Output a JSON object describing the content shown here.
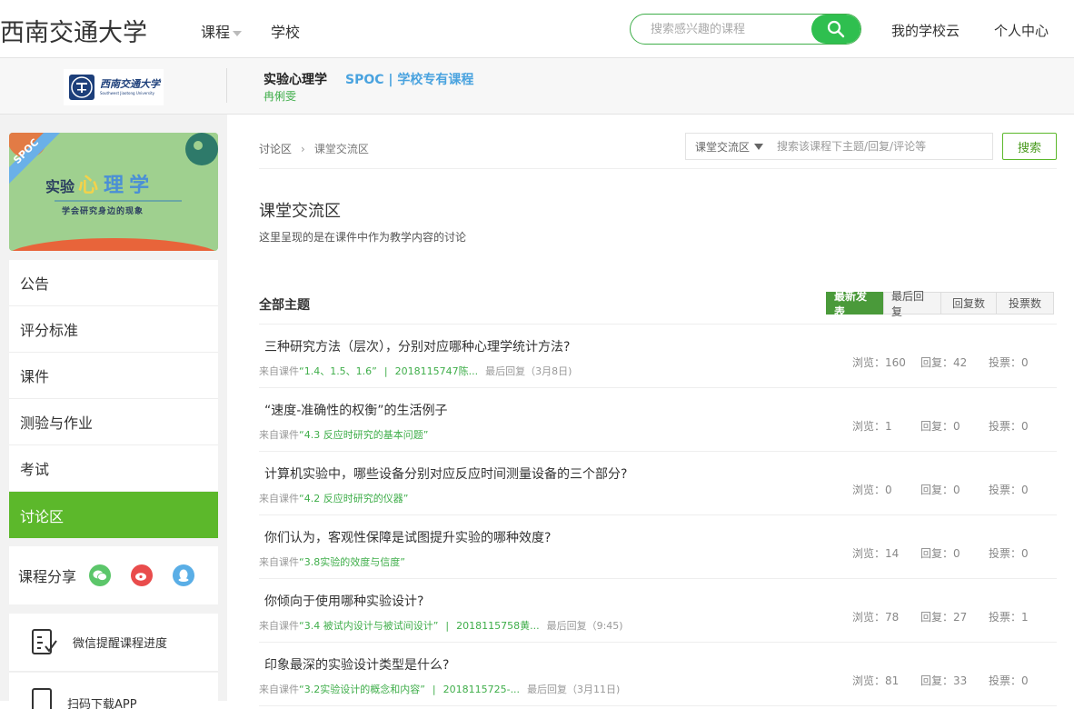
{
  "header": {
    "brand": "西南交通大学",
    "nav": [
      {
        "label": "课程",
        "has_caret": true
      },
      {
        "label": "学校",
        "has_caret": false
      }
    ],
    "search": {
      "placeholder": "搜索感兴趣的课程"
    },
    "links": [
      "我的学校云",
      "个人中心"
    ],
    "accent_color": "#2fbf4f"
  },
  "course_band": {
    "logo_cn": "西南交通大学",
    "logo_en": "Southwest Jiaotong University",
    "course_name": "实验心理学",
    "course_type": "SPOC | 学校专有课程",
    "teacher": "冉俐雯"
  },
  "sidebar": {
    "cover": {
      "badge": "SPOC",
      "title_chars": [
        "实",
        "验",
        "心",
        "理",
        "学"
      ],
      "subtitle": "学会研究身边的现象"
    },
    "menu": [
      {
        "label": "公告",
        "active": false
      },
      {
        "label": "评分标准",
        "active": false
      },
      {
        "label": "课件",
        "active": false
      },
      {
        "label": "测验与作业",
        "active": false
      },
      {
        "label": "考试",
        "active": false
      },
      {
        "label": "讨论区",
        "active": true
      }
    ],
    "share": {
      "label": "课程分享",
      "icons": [
        "wechat-icon",
        "weibo-icon",
        "qq-icon"
      ]
    },
    "remind": {
      "label": "微信提醒课程进度"
    },
    "app": {
      "label": "扫码下载APP"
    }
  },
  "main": {
    "breadcrumb": {
      "root": "讨论区",
      "current": "课堂交流区"
    },
    "scope_select": "课堂交流区",
    "search_placeholder": "搜索该课程下主题/回复/评论等",
    "search_button": "搜索",
    "forum_title": "课堂交流区",
    "forum_desc": "这里呈现的是在课件中作为教学内容的讨论",
    "all_topics": "全部主题",
    "sort_tabs": [
      {
        "label": "最新发表",
        "active": true
      },
      {
        "label": "最后回复",
        "active": false
      },
      {
        "label": "回复数",
        "active": false
      },
      {
        "label": "投票数",
        "active": false
      }
    ],
    "stat_labels": {
      "views": "浏览",
      "replies": "回复",
      "votes": "投票"
    },
    "topics": [
      {
        "title": "三种研究方法（层次），分别对应哪种心理学统计方法?",
        "source_prefix": "来自课件",
        "source": "“1.4、1.5、1.6”",
        "author": "2018115747陈...",
        "last_reply": "最后回复（3月8日)",
        "views": "160",
        "replies": "42",
        "votes": "0"
      },
      {
        "title": "“速度-准确性的权衡”的生活例子",
        "source_prefix": "来自课件",
        "source": "“4.3 反应时研究的基本问题”",
        "author": "",
        "last_reply": "",
        "views": "1",
        "replies": "0",
        "votes": "0"
      },
      {
        "title": "计算机实验中，哪些设备分别对应反应时间测量设备的三个部分?",
        "source_prefix": "来自课件",
        "source": "“4.2 反应时研究的仪器”",
        "author": "",
        "last_reply": "",
        "views": "0",
        "replies": "0",
        "votes": "0"
      },
      {
        "title": "你们认为，客观性保障是试图提升实验的哪种效度?",
        "source_prefix": "来自课件",
        "source": "“3.8实验的效度与信度”",
        "author": "",
        "last_reply": "",
        "views": "14",
        "replies": "0",
        "votes": "0"
      },
      {
        "title": "你倾向于使用哪种实验设计?",
        "source_prefix": "来自课件",
        "source": "“3.4 被试内设计与被试间设计”",
        "author": "2018115758黄...",
        "last_reply": "最后回复（9:45)",
        "views": "78",
        "replies": "27",
        "votes": "1"
      },
      {
        "title": "印象最深的实验设计类型是什么?",
        "source_prefix": "来自课件",
        "source": "“3.2实验设计的概念和内容”",
        "author": "2018115725-...",
        "last_reply": "最后回复（3月11日)",
        "views": "81",
        "replies": "33",
        "votes": "0"
      }
    ]
  }
}
